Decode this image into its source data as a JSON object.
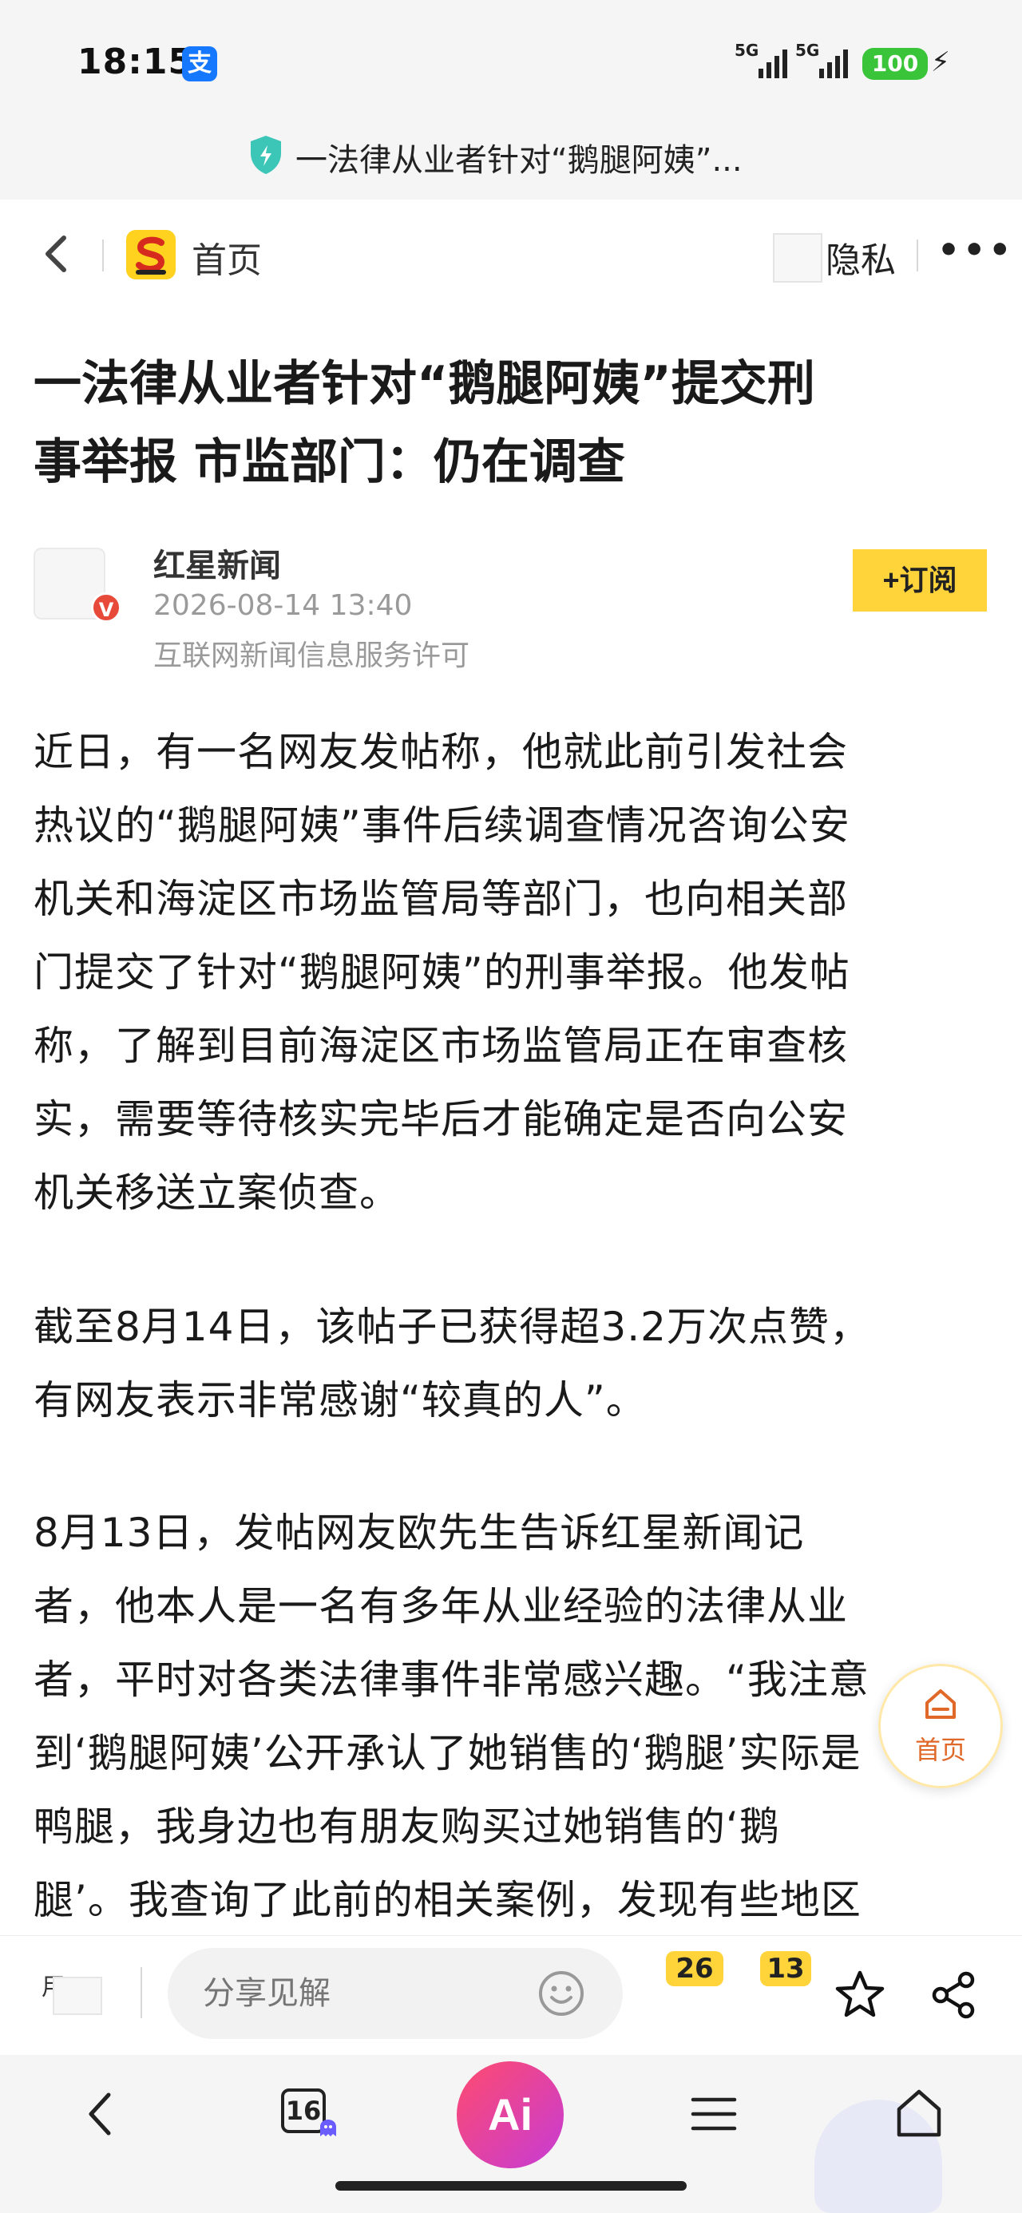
{
  "status_bar": {
    "time": "18:15",
    "alipay_badge": "支",
    "signal_1": "5G",
    "signal_2": "5G",
    "battery": "100"
  },
  "url_bar": {
    "title": "一法律从业者针对“鹅腿阿姨”..."
  },
  "nav": {
    "home_label": "首页",
    "privacy_label": "隐私",
    "more": "•••"
  },
  "article": {
    "headline_line1": "一法律从业者针对“鹅腿阿姨”提交刑",
    "headline_line2": "事举报 市监部门：仍在调查",
    "source_name": "红星新闻",
    "source_date": "2026-08-14 13:40",
    "source_license": "互联网新闻信息服务许可",
    "subscribe_label": "+订阅",
    "p1": [
      "近日，有一名网友发帖称，他就此前引发社会",
      "热议的“鹅腿阿姨”事件后续调查情况咨询公安",
      "机关和海淀区市场监管局等部门，也向相关部",
      "门提交了针对“鹅腿阿姨”的刑事举报。他发帖",
      "称，了解到目前海淀区市场监管局正在审查核",
      "实，需要等待核实完毕后才能确定是否向公安",
      "机关移送立案侦查。"
    ],
    "p2": [
      "截至8月14日，该帖子已获得超3.2万次点赞，",
      "有网友表示非常感谢“较真的人”。"
    ],
    "p3": [
      "8月13日，发帖网友欧先生告诉红星新闻记",
      "者，他本人是一名有多年从业经验的法律从业",
      "者，平时对各类法律事件非常感兴趣。“我注意",
      "到‘鹅腿阿姨’公开承认了她销售的‘鹅腿’实际是",
      "鸭腿，我身边也有朋友购买过她销售的‘鹅",
      "腿’。我查询了此前的相关案例，发现有些地区"
    ]
  },
  "float_home_label": "首页",
  "comment_bar": {
    "user_label": "用..",
    "placeholder": "分享见解",
    "comment_count": "26",
    "like_count": "13"
  },
  "bottom_nav": {
    "tabs_count": "16",
    "ai_label": "Ai"
  },
  "colors": {
    "accent_yellow": "#ffd43b",
    "ai_gradient_start": "#ff4b6e",
    "ai_gradient_end": "#c63bd6",
    "verified_red": "#e84a3a"
  }
}
